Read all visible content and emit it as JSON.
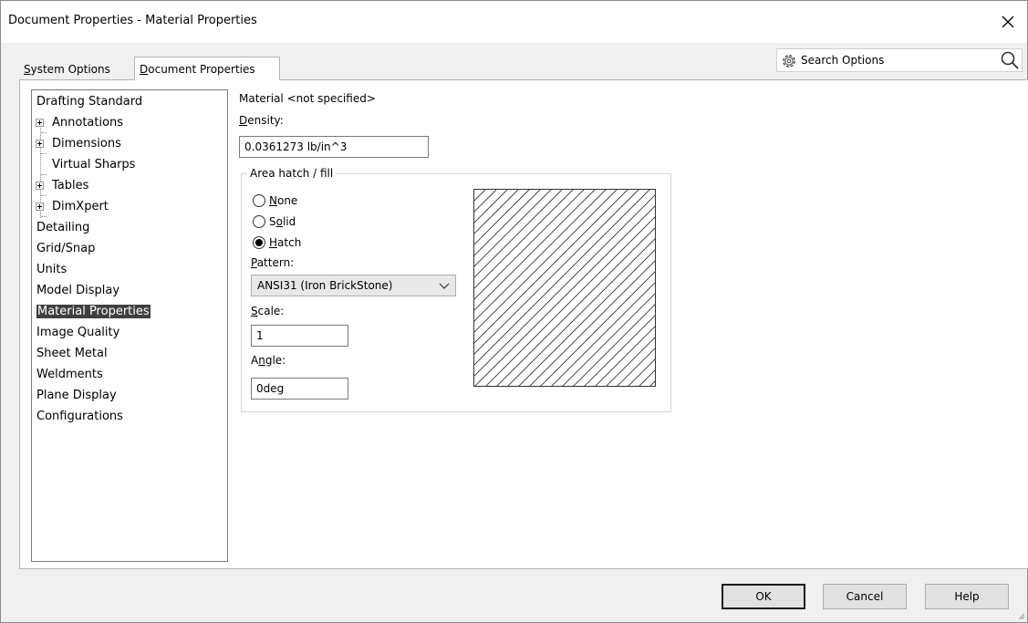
{
  "window": {
    "title": "Document Properties - Material Properties"
  },
  "tabs": [
    {
      "prefix": "",
      "accel": "S",
      "rest": "ystem Options",
      "active": false
    },
    {
      "prefix": "",
      "accel": "D",
      "rest": "ocument Properties",
      "active": true
    }
  ],
  "search": {
    "placeholder": "Search Options",
    "gear_icon": "gear-icon",
    "magnifier_icon": "magnifier-icon"
  },
  "tree": {
    "items": [
      {
        "label": "Drafting Standard",
        "level": 0,
        "expandable": false
      },
      {
        "label": "Annotations",
        "level": 1,
        "expandable": true
      },
      {
        "label": "Dimensions",
        "level": 1,
        "expandable": true
      },
      {
        "label": "Virtual Sharps",
        "level": 1,
        "expandable": false
      },
      {
        "label": "Tables",
        "level": 1,
        "expandable": true
      },
      {
        "label": "DimXpert",
        "level": 1,
        "expandable": true
      },
      {
        "label": "Detailing",
        "level": 0,
        "expandable": false
      },
      {
        "label": "Grid/Snap",
        "level": 0,
        "expandable": false
      },
      {
        "label": "Units",
        "level": 0,
        "expandable": false
      },
      {
        "label": "Model Display",
        "level": 0,
        "expandable": false
      },
      {
        "label": "Material Properties",
        "level": 0,
        "expandable": false,
        "selected": true
      },
      {
        "label": "Image Quality",
        "level": 0,
        "expandable": false
      },
      {
        "label": "Sheet Metal",
        "level": 0,
        "expandable": false
      },
      {
        "label": "Weldments",
        "level": 0,
        "expandable": false
      },
      {
        "label": "Plane Display",
        "level": 0,
        "expandable": false
      },
      {
        "label": "Configurations",
        "level": 0,
        "expandable": false
      }
    ]
  },
  "material": {
    "label": "Material <not specified>",
    "density_accel": "D",
    "density_rest": "ensity:",
    "density_value": "0.0361273 lb/in^3"
  },
  "hatch": {
    "group_title": "Area hatch / fill",
    "options": [
      {
        "accel": "N",
        "pre": "",
        "rest": "one",
        "checked": false
      },
      {
        "pre": "S",
        "accel": "o",
        "rest": "lid",
        "checked": false
      },
      {
        "accel": "H",
        "pre": "",
        "rest": "atch",
        "checked": true
      }
    ],
    "pattern_accel": "P",
    "pattern_rest": "attern:",
    "pattern_value": "ANSI31 (Iron BrickStone)",
    "scale_accel": "S",
    "scale_rest": "cale:",
    "scale_value": "1",
    "angle_pre": "A",
    "angle_accel": "n",
    "angle_rest": "gle:",
    "angle_value": "0deg"
  },
  "footer": {
    "ok": "OK",
    "cancel": "Cancel",
    "help": "Help"
  }
}
